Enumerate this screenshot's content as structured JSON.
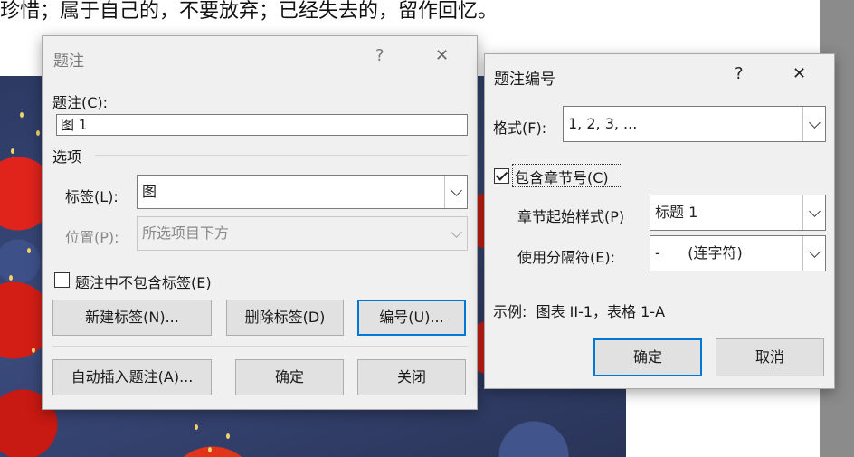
{
  "document": {
    "text_line": "珍惜；属于自己的，不要放弃；已经失去的，留作回忆。"
  },
  "caption_dialog": {
    "title": "题注",
    "help": "?",
    "close": "✕",
    "caption_label": "题注(C):",
    "caption_value": "图 1",
    "options_heading": "选项",
    "label_label": "标签(L):",
    "label_value": "图",
    "position_label": "位置(P):",
    "position_value": "所选项目下方",
    "exclude_label_text": "题注中不包含标签(E)",
    "exclude_label_checked": false,
    "new_label_btn": "新建标签(N)...",
    "delete_label_btn": "删除标签(D)",
    "numbering_btn": "编号(U)...",
    "autocaption_btn": "自动插入题注(A)...",
    "ok_btn": "确定",
    "close_btn": "关闭"
  },
  "numbering_dialog": {
    "title": "题注编号",
    "help": "?",
    "close": "✕",
    "format_label": "格式(F):",
    "format_value": "1, 2, 3, ...",
    "include_chapter_text": "包含章节号(C)",
    "include_chapter_checked": true,
    "chapter_style_label": "章节起始样式(P)",
    "chapter_style_value": "标题 1",
    "separator_label": "使用分隔符(E):",
    "separator_value": "-      (连字符)",
    "example_text": "示例:  图表 II-1，表格 1-A",
    "ok_btn": "确定",
    "cancel_btn": "取消"
  }
}
